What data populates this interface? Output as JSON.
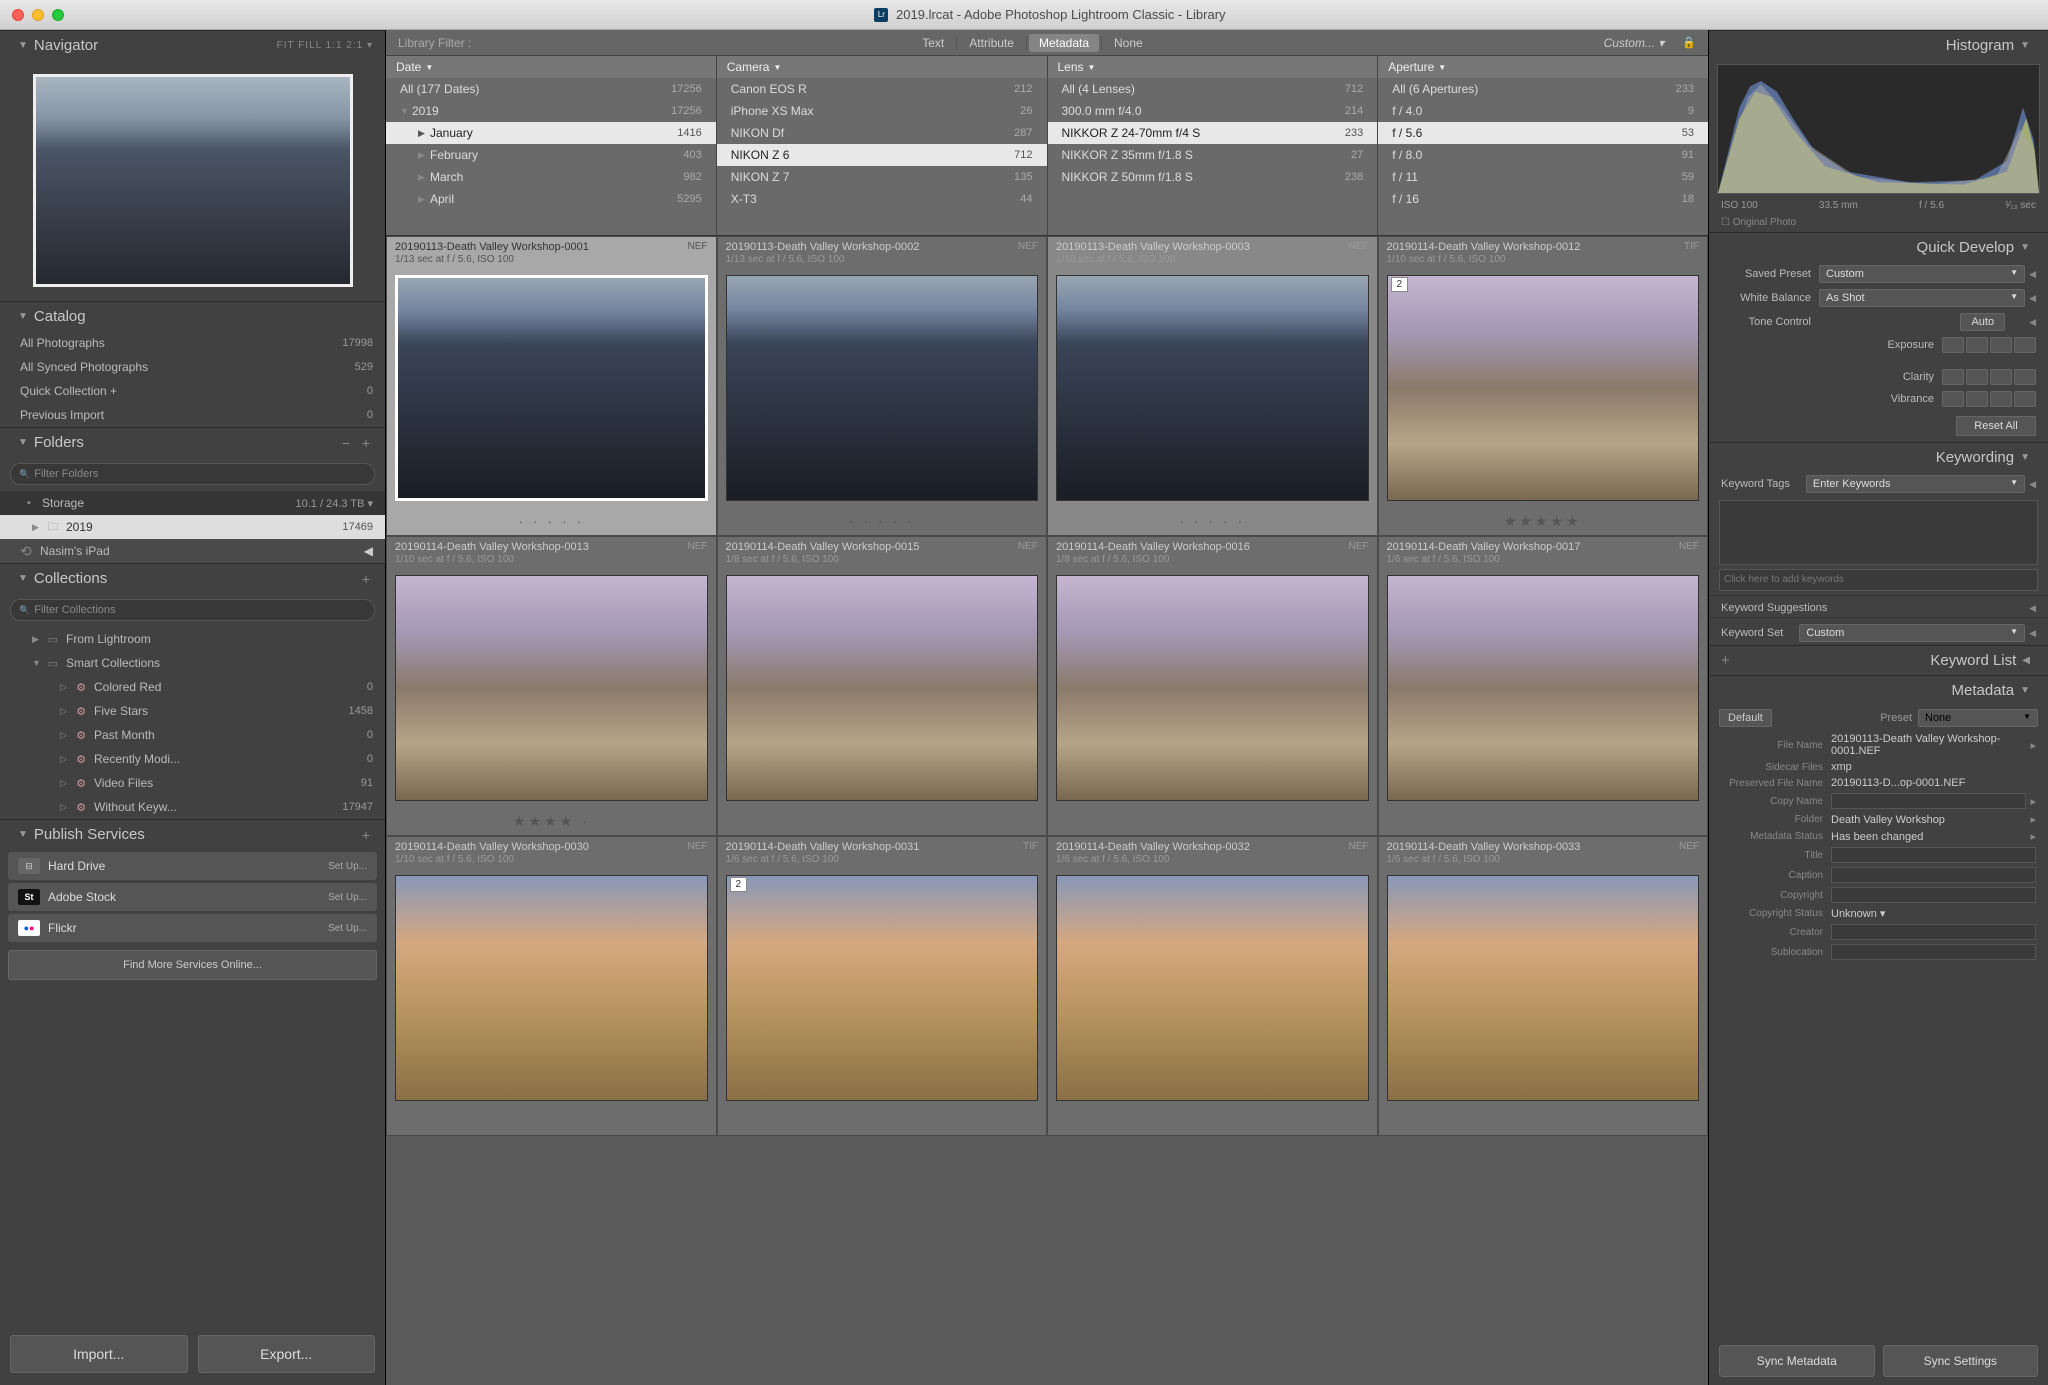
{
  "titlebar": {
    "title": "2019.lrcat - Adobe Photoshop Lightroom Classic - Library"
  },
  "navigator": {
    "title": "Navigator",
    "opts": "FIT   FILL   1:1   2:1  ▾"
  },
  "catalog": {
    "title": "Catalog",
    "rows": [
      {
        "label": "All Photographs",
        "count": "17998"
      },
      {
        "label": "All Synced Photographs",
        "count": "529"
      },
      {
        "label": "Quick Collection  +",
        "count": "0"
      },
      {
        "label": "Previous Import",
        "count": "0"
      }
    ]
  },
  "folders": {
    "title": "Folders",
    "filter_ph": "Filter Folders",
    "storage": {
      "label": "Storage",
      "info": "10.1 / 24.3 TB ▾"
    },
    "year": {
      "label": "2019",
      "count": "17469"
    },
    "ipad": {
      "label": "Nasim's iPad"
    }
  },
  "collections": {
    "title": "Collections",
    "filter_ph": "Filter Collections",
    "from_lr": "From Lightroom",
    "smart": "Smart Collections",
    "items": [
      {
        "label": "Colored Red",
        "count": "0"
      },
      {
        "label": "Five Stars",
        "count": "1458"
      },
      {
        "label": "Past Month",
        "count": "0"
      },
      {
        "label": "Recently Modi...",
        "count": "0"
      },
      {
        "label": "Video Files",
        "count": "91"
      },
      {
        "label": "Without Keyw...",
        "count": "17947"
      }
    ]
  },
  "publish": {
    "title": "Publish Services",
    "hd": "Hard Drive",
    "as": "Adobe Stock",
    "fl": "Flickr",
    "setup": "Set Up...",
    "find": "Find More Services Online..."
  },
  "buttons": {
    "import": "Import...",
    "export": "Export..."
  },
  "filterbar": {
    "label": "Library Filter :",
    "text": "Text",
    "attribute": "Attribute",
    "metadata": "Metadata",
    "none": "None",
    "custom": "Custom... ▾"
  },
  "metacols": {
    "date": {
      "title": "Date",
      "rows": [
        {
          "label": "All (177 Dates)",
          "count": "17256",
          "arr": ""
        },
        {
          "label": "2019",
          "count": "17256",
          "arr": "▼",
          "sel": false
        },
        {
          "label": "January",
          "count": "1416",
          "arr": "▶",
          "sel": true
        },
        {
          "label": "February",
          "count": "403",
          "arr": "▶"
        },
        {
          "label": "March",
          "count": "982",
          "arr": "▶"
        },
        {
          "label": "April",
          "count": "5295",
          "arr": "▶"
        }
      ]
    },
    "camera": {
      "title": "Camera",
      "rows": [
        {
          "label": "Canon EOS R",
          "count": "212"
        },
        {
          "label": "iPhone XS Max",
          "count": "26"
        },
        {
          "label": "NIKON Df",
          "count": "287"
        },
        {
          "label": "NIKON Z 6",
          "count": "712",
          "sel": true
        },
        {
          "label": "NIKON Z 7",
          "count": "135"
        },
        {
          "label": "X-T3",
          "count": "44"
        }
      ]
    },
    "lens": {
      "title": "Lens",
      "rows": [
        {
          "label": "All (4 Lenses)",
          "count": "712"
        },
        {
          "label": "300.0 mm f/4.0",
          "count": "214"
        },
        {
          "label": "NIKKOR Z 24-70mm f/4 S",
          "count": "233",
          "sel": true
        },
        {
          "label": "NIKKOR Z 35mm f/1.8 S",
          "count": "27"
        },
        {
          "label": "NIKKOR Z 50mm f/1.8 S",
          "count": "238"
        }
      ]
    },
    "aperture": {
      "title": "Aperture",
      "rows": [
        {
          "label": "All (6 Apertures)",
          "count": "233"
        },
        {
          "label": "f / 4.0",
          "count": "9"
        },
        {
          "label": "f / 5.6",
          "count": "53",
          "sel": true
        },
        {
          "label": "f / 8.0",
          "count": "91"
        },
        {
          "label": "f / 11",
          "count": "59"
        },
        {
          "label": "f / 16",
          "count": "18"
        }
      ]
    }
  },
  "grid": [
    [
      {
        "name": "20190113-Death Valley Workshop-0001",
        "meta": "1/13 sec at f / 5.6, ISO 100",
        "ext": "NEF",
        "cls": "th-dark",
        "sel": "sel",
        "stars": "·  ·  ·  ·  ·"
      },
      {
        "name": "20190113-Death Valley Workshop-0002",
        "meta": "1/13 sec at f / 5.6, ISO 100",
        "ext": "NEF",
        "cls": "th-dark",
        "stars": "·  ·  ·  ·  ·"
      },
      {
        "name": "20190113-Death Valley Workshop-0003",
        "meta": "1/10 sec at f / 5.6, ISO 100",
        "ext": "NEF",
        "cls": "th-dark",
        "sel": "sel2",
        "stars": "·  ·  ·  ·  ·"
      },
      {
        "name": "20190114-Death Valley Workshop-0012",
        "meta": "1/10 sec at f / 5.6, ISO 100",
        "ext": "TIF",
        "cls": "th-zab",
        "stack": "2",
        "stars": "★★★★★"
      }
    ],
    [
      {
        "name": "20190114-Death Valley Workshop-0013",
        "meta": "1/10 sec at f / 5.6, ISO 100",
        "ext": "NEF",
        "cls": "th-zab",
        "stars": "★★★★ ·"
      },
      {
        "name": "20190114-Death Valley Workshop-0015",
        "meta": "1/8 sec at f / 5.6, ISO 100",
        "ext": "NEF",
        "cls": "th-zab",
        "stars": ""
      },
      {
        "name": "20190114-Death Valley Workshop-0016",
        "meta": "1/8 sec at f / 5.6, ISO 100",
        "ext": "NEF",
        "cls": "th-zab",
        "stars": ""
      },
      {
        "name": "20190114-Death Valley Workshop-0017",
        "meta": "1/6 sec at f / 5.6, ISO 100",
        "ext": "NEF",
        "cls": "th-zab",
        "stars": ""
      }
    ],
    [
      {
        "name": "20190114-Death Valley Workshop-0030",
        "meta": "1/10 sec at f / 5.6, ISO 100",
        "ext": "NEF",
        "cls": "th-zab2",
        "stars": ""
      },
      {
        "name": "20190114-Death Valley Workshop-0031",
        "meta": "1/6 sec at f / 5.6, ISO 100",
        "ext": "TIF",
        "cls": "th-zab2",
        "stack": "2",
        "stars": ""
      },
      {
        "name": "20190114-Death Valley Workshop-0032",
        "meta": "1/6 sec at f / 5.6, ISO 100",
        "ext": "NEF",
        "cls": "th-zab2",
        "stars": ""
      },
      {
        "name": "20190114-Death Valley Workshop-0033",
        "meta": "1/6 sec at f / 5.6, ISO 100",
        "ext": "NEF",
        "cls": "th-zab2",
        "stars": ""
      }
    ]
  ],
  "histogram": {
    "title": "Histogram",
    "iso": "ISO 100",
    "focal": "33.5 mm",
    "ap": "f / 5.6",
    "sh": "¹⁄₁₃ sec",
    "orig": "Original Photo"
  },
  "quickdev": {
    "title": "Quick Develop",
    "preset_lbl": "Saved Preset",
    "preset_val": "Custom",
    "wb_lbl": "White Balance",
    "wb_val": "As Shot",
    "tone_lbl": "Tone Control",
    "auto": "Auto",
    "exp_lbl": "Exposure",
    "clarity_lbl": "Clarity",
    "vib_lbl": "Vibrance",
    "reset": "Reset All"
  },
  "keywording": {
    "title": "Keywording",
    "tags_lbl": "Keyword Tags",
    "tags_val": "Enter Keywords",
    "add_ph": "Click here to add keywords",
    "sugg": "Keyword Suggestions",
    "set_lbl": "Keyword Set",
    "set_val": "Custom"
  },
  "keywordlist": {
    "title": "Keyword List"
  },
  "metadata": {
    "title": "Metadata",
    "tab": "Default",
    "preset_lbl": "Preset",
    "preset_val": "None",
    "rows": [
      {
        "k": "File Name",
        "v": "20190113-Death Valley Workshop-0001.NEF",
        "arr": "▸"
      },
      {
        "k": "Sidecar Files",
        "v": "xmp"
      },
      {
        "k": "Preserved File Name",
        "v": "20190113-D...op-0001.NEF"
      },
      {
        "k": "Copy Name",
        "v": "",
        "input": true,
        "arr": "▸"
      },
      {
        "k": "Folder",
        "v": "Death Valley Workshop",
        "arr": "▸"
      },
      {
        "k": "Metadata Status",
        "v": "Has been changed",
        "arr": "▸"
      },
      {
        "k": "Title",
        "v": "",
        "input": true
      },
      {
        "k": "Caption",
        "v": "",
        "input": true
      },
      {
        "k": "Copyright",
        "v": "",
        "input": true
      },
      {
        "k": "Copyright Status",
        "v": "Unknown  ▾"
      },
      {
        "k": "Creator",
        "v": "",
        "input": true
      },
      {
        "k": "Sublocation",
        "v": "",
        "input": true
      }
    ],
    "sync_meta": "Sync Metadata",
    "sync_set": "Sync Settings"
  }
}
